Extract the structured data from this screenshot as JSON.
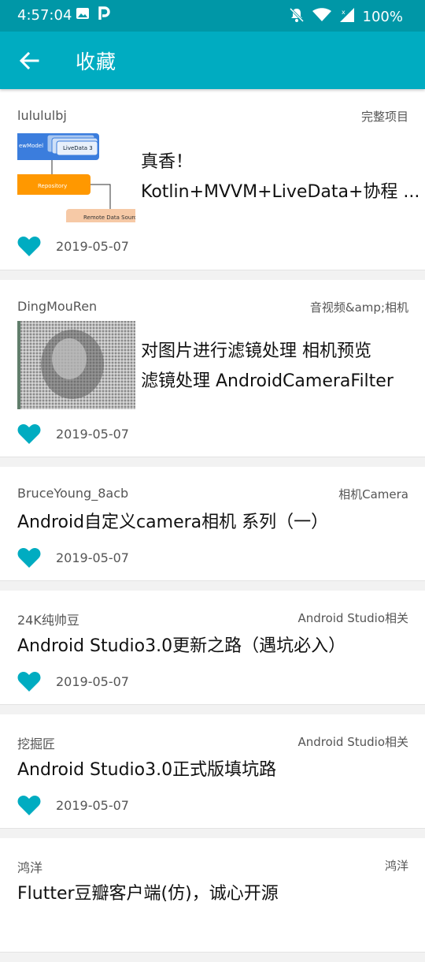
{
  "status_bar": {
    "time": "4:57:04",
    "battery": "100%",
    "icons": [
      "image-icon",
      "p-icon",
      "bell-off-icon",
      "wifi-icon",
      "signal-icon",
      "battery-icon"
    ]
  },
  "app_bar": {
    "title": "收藏",
    "back_icon": "arrow-back-icon",
    "color": "#00acc1"
  },
  "accent": "#00acc1",
  "items": [
    {
      "author": "lulululbj",
      "category": "完整项目",
      "title_lines": [
        "真香！",
        "Kotlin+MVVM+LiveData+协程 ..."
      ],
      "date": "2019-05-07",
      "thumbnail": {
        "type": "diagram",
        "labels": [
          "ewModel",
          "LiveData 3",
          "Repository",
          "Remote Data Source"
        ]
      },
      "liked": true
    },
    {
      "author": "DingMouRen",
      "category": "音视频&amp;相机",
      "title_lines": [
        "对图片进行滤镜处理 相机预览",
        "滤镜处理 AndroidCameraFilter"
      ],
      "date": "2019-05-07",
      "thumbnail": {
        "type": "photo"
      },
      "liked": true
    },
    {
      "author": "BruceYoung_8acb",
      "category": "相机Camera",
      "title_lines": [
        "Android自定义camera相机 系列（一）"
      ],
      "date": "2019-05-07",
      "liked": true
    },
    {
      "author": "24K纯帅豆",
      "category": "Android Studio相关",
      "title_lines": [
        "Android Studio3.0更新之路（遇坑必入）"
      ],
      "date": "2019-05-07",
      "liked": true
    },
    {
      "author": "挖掘匠",
      "category": "Android Studio相关",
      "title_lines": [
        "Android Studio3.0正式版填坑路"
      ],
      "date": "2019-05-07",
      "liked": true
    },
    {
      "author": "鸿洋",
      "category": "鸿洋",
      "title_lines": [
        "Flutter豆瓣客户端(仿)，诚心开源"
      ],
      "date": "",
      "liked": true
    }
  ]
}
